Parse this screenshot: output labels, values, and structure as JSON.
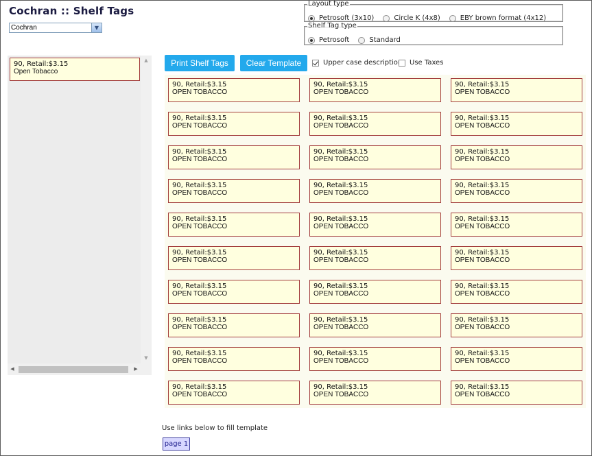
{
  "header": {
    "title": "Cochran :: Shelf Tags"
  },
  "store_select": {
    "value": "Cochran"
  },
  "layout_type": {
    "legend": "Layout type",
    "options": [
      {
        "label": "Petrosoft (3x10)",
        "selected": true
      },
      {
        "label": "Circle K (4x8)",
        "selected": false
      },
      {
        "label": "EBY brown format (4x12)",
        "selected": false
      }
    ]
  },
  "shelf_tag_type": {
    "legend": "Shelf Tag type",
    "options": [
      {
        "label": "Petrosoft",
        "selected": true
      },
      {
        "label": "Standard",
        "selected": false
      }
    ]
  },
  "toolbar": {
    "print_label": "Print Shelf Tags",
    "clear_label": "Clear Template",
    "uppercase_label": "Upper case description",
    "uppercase_checked": true,
    "taxes_label": "Use Taxes",
    "taxes_checked": false
  },
  "item_list": [
    {
      "line1": "90,  Retail:$3.15",
      "line2": "Open Tobacco"
    }
  ],
  "template": {
    "columns": 3,
    "rows": 10,
    "tag_line1": "90,  Retail:$3.15",
    "tag_line2": "OPEN TOBACCO"
  },
  "footer": {
    "hint": "Use links below to fill template",
    "page_link": "page 1"
  },
  "colors": {
    "accent": "#23a9ec",
    "tag_bg": "#ffffdf",
    "tag_border": "#a23b3b",
    "title": "#1a1a40"
  }
}
